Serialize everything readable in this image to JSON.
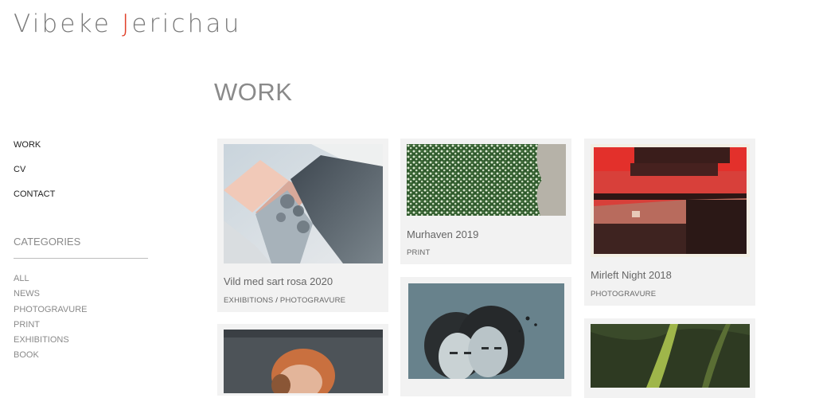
{
  "site": {
    "title_before": "Vibeke ",
    "title_accent": "J",
    "title_after": "erichau",
    "accent_color": "#e0402a"
  },
  "page": {
    "title": "WORK"
  },
  "nav": {
    "items": [
      {
        "label": "WORK"
      },
      {
        "label": "CV"
      },
      {
        "label": "CONTACT"
      }
    ]
  },
  "categories": {
    "heading": "CATEGORIES",
    "items": [
      {
        "label": "ALL"
      },
      {
        "label": "NEWS"
      },
      {
        "label": "PHOTOGRAVURE"
      },
      {
        "label": "PRINT"
      },
      {
        "label": "EXHIBITIONS"
      },
      {
        "label": "BOOK"
      }
    ]
  },
  "works": [
    {
      "title": "Vild med sart rosa 2020",
      "tags": [
        "EXHIBITIONS",
        "PHOTOGRAVURE"
      ],
      "tag_separator": " / "
    },
    {
      "title": "Murhaven 2019",
      "tags": [
        "PRINT"
      ]
    },
    {
      "title": "Mirleft Night 2018",
      "tags": [
        "PHOTOGRAVURE"
      ]
    }
  ]
}
